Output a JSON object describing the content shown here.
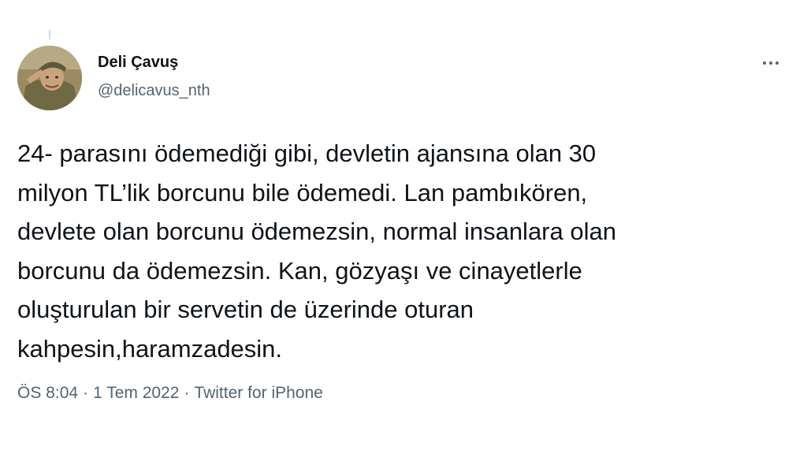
{
  "author": {
    "display_name": "Deli Çavuş",
    "handle": "@delicavus_nth"
  },
  "tweet": {
    "text": "24- parasını ödemediği gibi, devletin ajansına olan 30\nmilyon TL’lik borcunu bile ödemedi. Lan pambıkören,\ndevlete olan borcunu ödemezsin, normal insanlara olan\nborcunu da ödemezsin. Kan, gözyaşı ve cinayetlerle\noluşturulan bir servetin de üzerinde oturan\nkahpesin,haramzadesin."
  },
  "meta": {
    "time": "ÖS 8:04",
    "date": "1 Tem 2022",
    "source": "Twitter for iPhone",
    "separator": "·"
  },
  "icons": {
    "more": "more-horizontal-icon"
  },
  "colors": {
    "text_primary": "#0f1419",
    "text_secondary": "#536471",
    "background": "#ffffff"
  }
}
